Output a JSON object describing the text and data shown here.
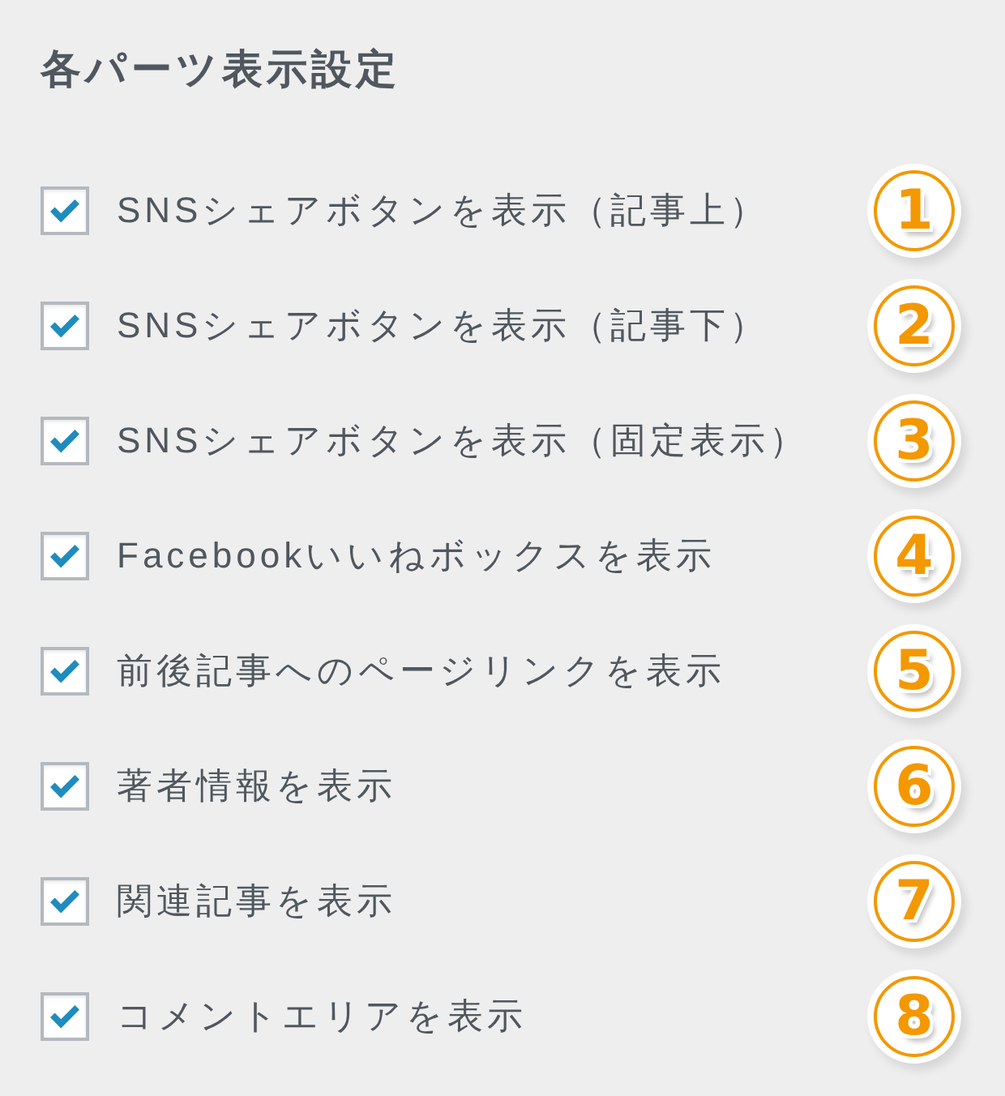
{
  "section": {
    "title": "各パーツ表示設定"
  },
  "items": [
    {
      "label": "SNSシェアボタンを表示（記事上）",
      "checked": true,
      "badge": "1"
    },
    {
      "label": "SNSシェアボタンを表示（記事下）",
      "checked": true,
      "badge": "2"
    },
    {
      "label": "SNSシェアボタンを表示（固定表示）",
      "checked": true,
      "badge": "3"
    },
    {
      "label": "Facebookいいねボックスを表示",
      "checked": true,
      "badge": "4"
    },
    {
      "label": "前後記事へのページリンクを表示",
      "checked": true,
      "badge": "5"
    },
    {
      "label": "著者情報を表示",
      "checked": true,
      "badge": "6"
    },
    {
      "label": "関連記事を表示",
      "checked": true,
      "badge": "7"
    },
    {
      "label": "コメントエリアを表示",
      "checked": true,
      "badge": "8"
    }
  ]
}
